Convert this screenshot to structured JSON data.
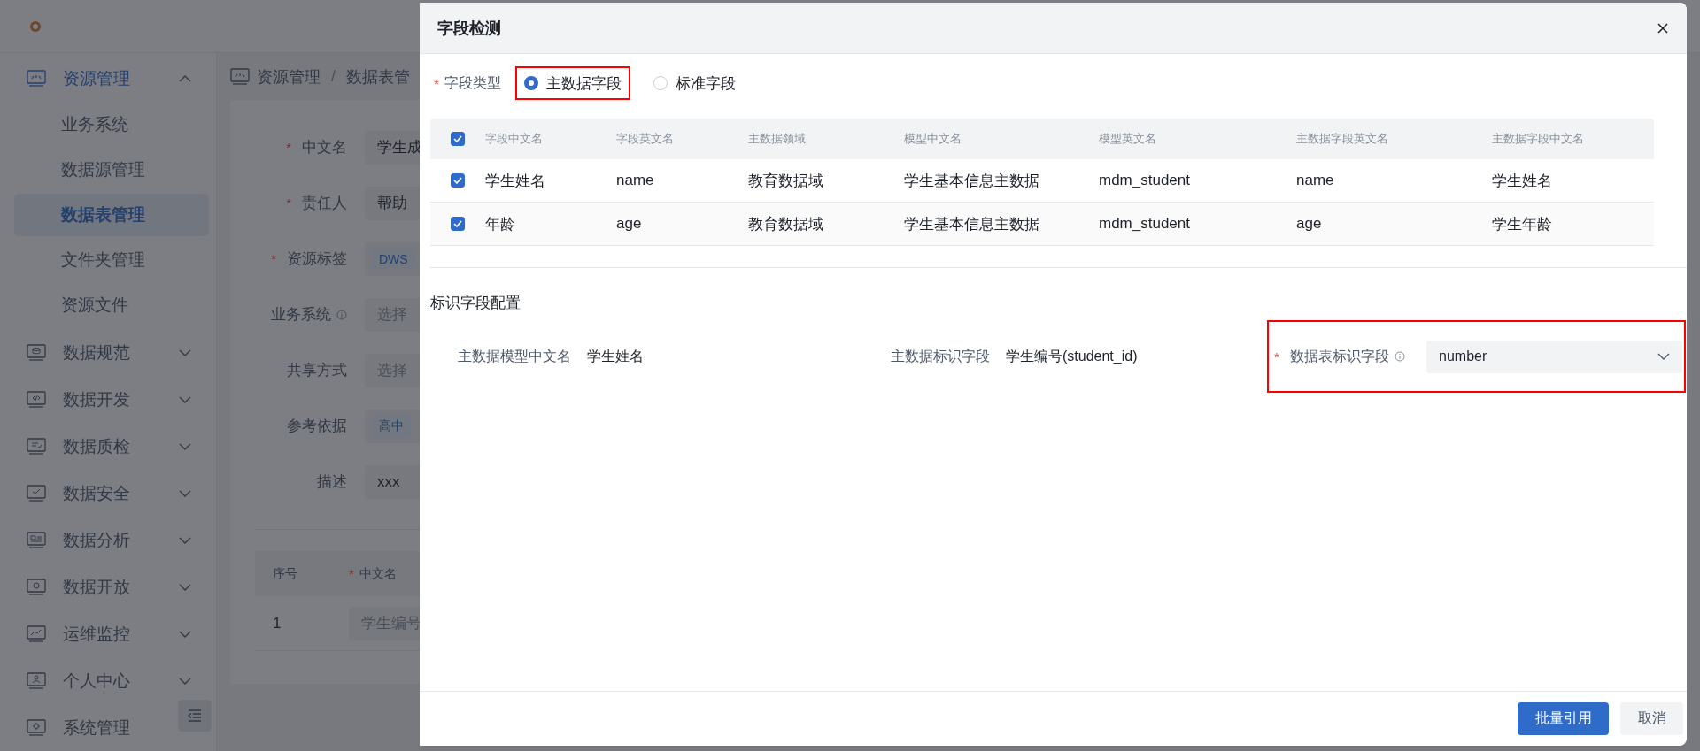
{
  "sidebar": {
    "menu": [
      {
        "label": "资源管理",
        "expanded": true,
        "children": [
          {
            "label": "业务系统",
            "selected": false
          },
          {
            "label": "数据源管理",
            "selected": false
          },
          {
            "label": "数据表管理",
            "selected": true
          },
          {
            "label": "文件夹管理",
            "selected": false
          },
          {
            "label": "资源文件",
            "selected": false
          }
        ]
      },
      {
        "label": "数据规范",
        "expanded": false
      },
      {
        "label": "数据开发",
        "expanded": false
      },
      {
        "label": "数据质检",
        "expanded": false
      },
      {
        "label": "数据安全",
        "expanded": false
      },
      {
        "label": "数据分析",
        "expanded": false
      },
      {
        "label": "数据开放",
        "expanded": false
      },
      {
        "label": "运维监控",
        "expanded": false
      },
      {
        "label": "个人中心",
        "expanded": false
      },
      {
        "label": "系统管理"
      }
    ]
  },
  "breadcrumb": {
    "separator": "/",
    "items": [
      "资源管理",
      "数据表管"
    ]
  },
  "form": {
    "fields": [
      {
        "label": "中文名",
        "required_mark": "*",
        "kind": "input",
        "value": "学生成"
      },
      {
        "label": "责任人",
        "required_mark": "*",
        "kind": "input",
        "value": "帮助"
      },
      {
        "label": "资源标签",
        "required_mark": "*",
        "kind": "tag",
        "value": "DWS"
      },
      {
        "label": "业务系统",
        "info": true,
        "kind": "input",
        "placeholder": "选择"
      },
      {
        "label": "共享方式",
        "kind": "input",
        "placeholder": "选择"
      },
      {
        "label": "参考依据",
        "kind": "tag",
        "value": "高中"
      },
      {
        "label": "描述",
        "kind": "input",
        "value": "xxx"
      }
    ]
  },
  "form_table": {
    "columns": [
      {
        "label": "序号"
      },
      {
        "label": "中文名",
        "required_mark": "*"
      }
    ],
    "rows": [
      {
        "index": "1",
        "placeholder": "学生编号"
      }
    ]
  },
  "drawer": {
    "title": "字段检测",
    "field_type": {
      "label": "字段类型",
      "required_mark": "*",
      "options": [
        {
          "label": "主数据字段",
          "selected": true,
          "highlighted": true
        },
        {
          "label": "标准字段",
          "selected": false,
          "highlighted": false
        }
      ]
    },
    "table": {
      "all_checked": true,
      "columns": [
        "字段中文名",
        "字段英文名",
        "主数据领域",
        "模型中文名",
        "模型英文名",
        "主数据字段英文名",
        "主数据字段中文名"
      ],
      "rows": [
        {
          "checked": true,
          "cells": [
            "学生姓名",
            "name",
            "教育数据域",
            "学生基本信息主数据",
            "mdm_student",
            "name",
            "学生姓名"
          ]
        },
        {
          "checked": true,
          "cells": [
            "年龄",
            "age",
            "教育数据域",
            "学生基本信息主数据",
            "mdm_student",
            "age",
            "学生年龄"
          ]
        }
      ]
    },
    "config": {
      "title": "标识字段配置",
      "items": [
        {
          "kind": "text",
          "label": "主数据模型中文名",
          "value": "学生姓名"
        },
        {
          "kind": "text",
          "label": "主数据标识字段",
          "value": "学生编号(student_id)"
        },
        {
          "kind": "select",
          "label": "数据表标识字段",
          "required_mark": "*",
          "info": true,
          "value": "number",
          "highlighted": true
        }
      ]
    },
    "buttons": [
      {
        "label": "批量引用",
        "kind": "primary"
      },
      {
        "label": "取消",
        "kind": "default"
      }
    ]
  }
}
